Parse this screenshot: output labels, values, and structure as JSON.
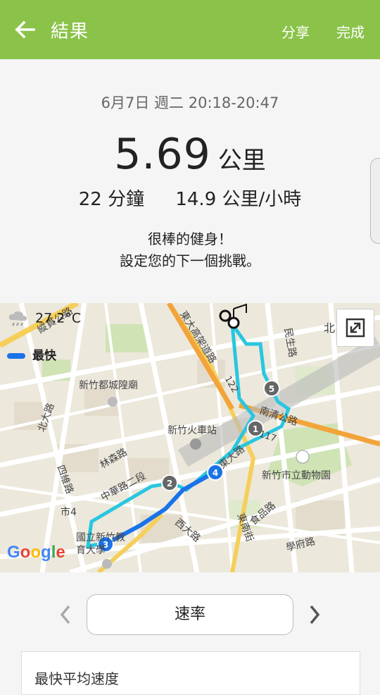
{
  "header": {
    "title": "結果",
    "share": "分享",
    "done": "完成"
  },
  "summary": {
    "date": "6月7日 週二 20:18-20:47",
    "distance_value": "5.69",
    "distance_unit": "公里",
    "duration": "22 分鐘",
    "speed": "14.9 公里/小時",
    "message_line1": "很棒的健身！",
    "message_line2": "設定您的下一個挑戰。"
  },
  "map": {
    "temperature": "27.2°C",
    "legend_label": "最快",
    "legend_color": "#1a73e8",
    "route_color": "#29c6e0",
    "google_logo": "Google",
    "labels": [
      "縱貫公路",
      "東大高架道路",
      "民生路",
      "北",
      "新竹都城隍廟",
      "北大路",
      "南清公路",
      "新竹火車站",
      "新竹市立動物園",
      "林森路",
      "中華路二段",
      "四維路",
      "市4",
      "東大路",
      "食品路",
      "東南街",
      "學府路",
      "西大路",
      "國立新竹教育大學",
      "122",
      "117"
    ],
    "markers": [
      "1",
      "2",
      "3",
      "4",
      "5"
    ]
  },
  "bottom": {
    "metric_selector": "速率",
    "card_title": "最快平均速度"
  }
}
